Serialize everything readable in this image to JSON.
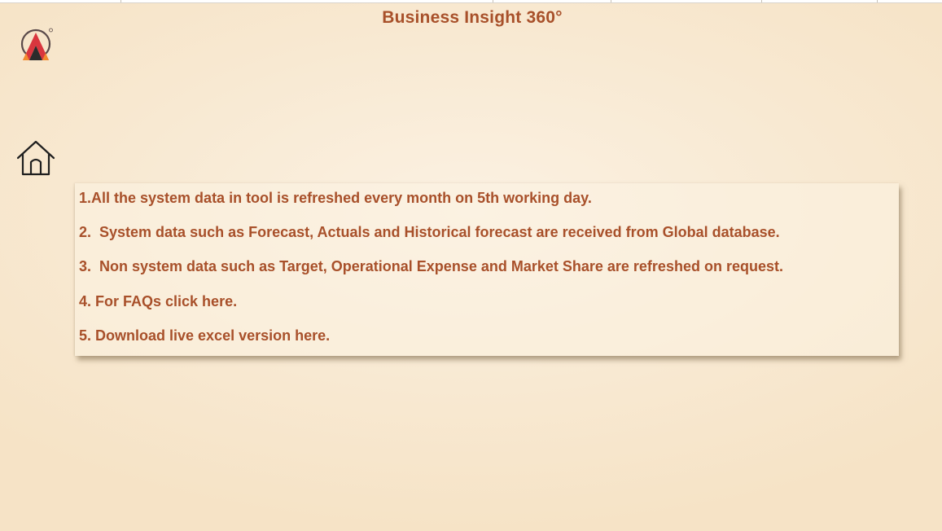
{
  "header": {
    "title": "Business Insight 360°"
  },
  "logo": {
    "icon": "company-logo-icon",
    "colors": {
      "ring": "#5a4a4a",
      "triangle_top": "#d9363e",
      "triangle_bottom": "#f28a2e",
      "inner": "#2b2b2b"
    }
  },
  "nav": {
    "home_icon": "home-icon"
  },
  "info": {
    "items": [
      "1.All the system data in tool is refreshed every month on 5th working day.",
      "2.  System data such as Forecast, Actuals and Historical forecast are received from Global database.",
      "3.  Non system data such as Target, Operational Expense and Market Share are refreshed on request.",
      "4. For FAQs click here.",
      "5. Download live excel version here."
    ]
  },
  "colors": {
    "accent_text": "#a8502a",
    "background": "#f8e9d2"
  }
}
